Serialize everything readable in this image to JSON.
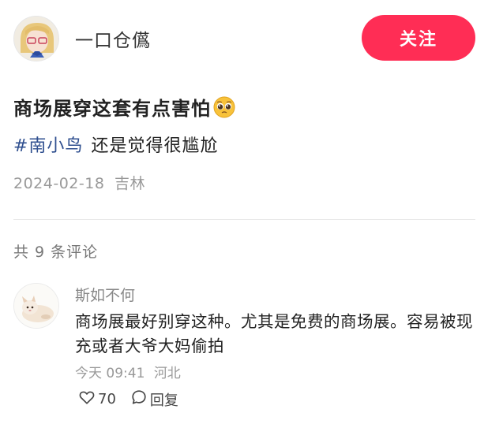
{
  "author": {
    "name": "一口仓儰",
    "follow_label": "关注"
  },
  "post": {
    "title": "商场展穿这套有点害怕",
    "title_emoji": "pleading-face-emoji",
    "hashtag": "#南小鸟",
    "body_text": "还是觉得很尴尬",
    "date": "2024-02-18",
    "location": "吉林"
  },
  "comments_header": "共 9 条评论",
  "comment": {
    "user": "斯如不何",
    "text": "商场展最好别穿这种。尤其是免费的商场展。容易被现充或者大爷大妈偷拍",
    "time": "今天 09:41",
    "location": "河北",
    "likes": "70",
    "reply_label": "回复",
    "like_icon": "heart-outline-icon",
    "reply_icon": "speech-bubble-icon"
  },
  "colors": {
    "accent": "#ff2d55",
    "hashtag": "#2f4f8f",
    "meta": "#999999"
  }
}
